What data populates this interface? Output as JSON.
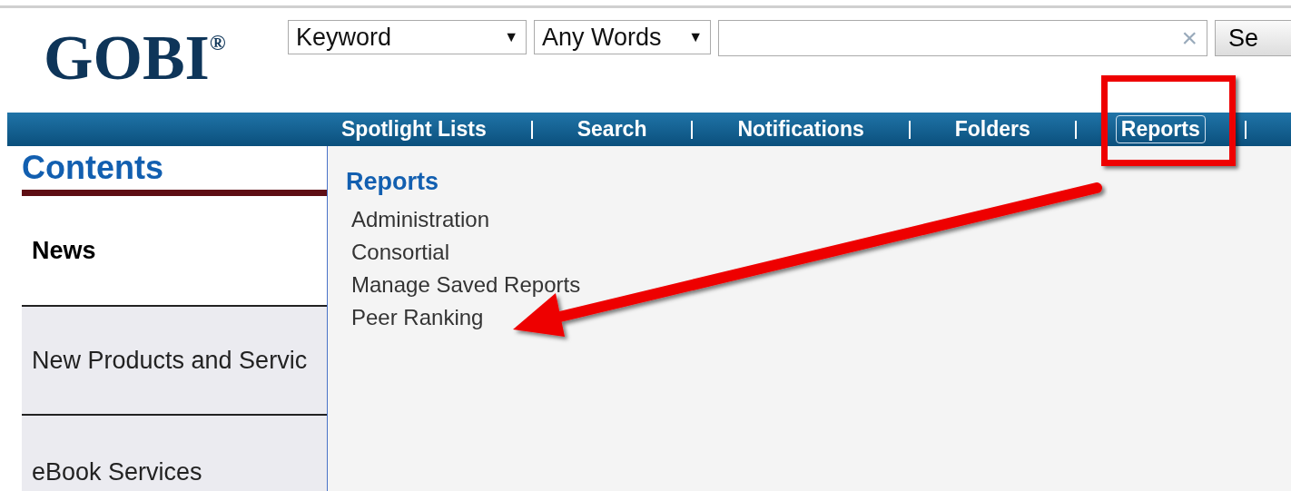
{
  "logo": {
    "text": "GOBI",
    "mark": "®"
  },
  "search": {
    "field_select": "Keyword",
    "match_select": "Any Words",
    "caret": "▼",
    "clear": "×",
    "button": "Se"
  },
  "nav": [
    {
      "label": "Spotlight Lists",
      "selected": false
    },
    {
      "label": "Search",
      "selected": false
    },
    {
      "label": "Notifications",
      "selected": false
    },
    {
      "label": "Folders",
      "selected": false
    },
    {
      "label": "Reports",
      "selected": true
    }
  ],
  "sidebar": {
    "title": "Contents",
    "items": [
      {
        "label": "News",
        "selected": true
      },
      {
        "label": "New Products and Servic",
        "selected": false
      },
      {
        "label": "eBook Services",
        "selected": false
      }
    ]
  },
  "panel": {
    "title": "Reports",
    "links": [
      "Administration",
      "Consortial",
      "Manage Saved Reports",
      "Peer Ranking"
    ]
  },
  "annotations": {
    "highlight_box": true,
    "arrow": true
  }
}
